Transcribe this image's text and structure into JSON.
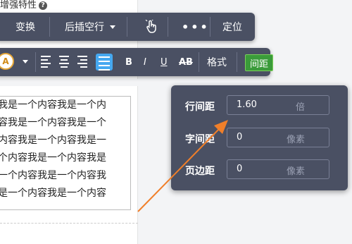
{
  "header": {
    "title": "增强特性",
    "help_glyph": "?"
  },
  "toolbar1": {
    "replace_label": "变换",
    "insert_label": "后插空行",
    "more_label": "•••",
    "locate_label": "定位",
    "touch_icon": "pointer-hand-icon"
  },
  "toolbar2": {
    "color_label": "A",
    "bold_label": "B",
    "italic_label": "I",
    "underline_label": "U",
    "strike_label": "AB",
    "format_label": "格式",
    "spacing_label": "间距",
    "colors": {
      "spacing_active": "#3a9b3a",
      "justify_active": "#45a8f0",
      "toolbar_bg": "#4a5063"
    }
  },
  "content": {
    "lines": [
      "我是一个内容我是一个内",
      "容我是一个内容我是一个",
      "内容我是一个内容我是一",
      "个内容我是一个内容我是",
      "一个内容我是一个内容我",
      "是一个内容我是一个内容"
    ]
  },
  "panel": {
    "line_spacing_label": "行间距",
    "line_spacing_value": "1.60",
    "line_spacing_unit": "倍",
    "letter_spacing_label": "字间距",
    "letter_spacing_value": "0",
    "letter_spacing_unit": "像素",
    "page_margin_label": "页边距",
    "page_margin_value": "0",
    "page_margin_unit": "像素"
  },
  "annotation": {
    "arrow_color": "#f07f2a"
  }
}
